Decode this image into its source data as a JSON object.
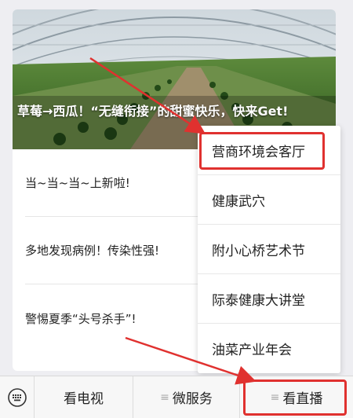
{
  "article": {
    "hero_title": "草莓→西瓜！“无缝衔接”的甜蜜快乐，快来Get!",
    "items": [
      {
        "title": "当~当~当~上新啦!"
      },
      {
        "title": "多地发现病例！传染性强!"
      },
      {
        "title": "警惕夏季“头号杀手”!"
      }
    ]
  },
  "menu": {
    "items": [
      {
        "label": "营商环境会客厅",
        "highlighted": true
      },
      {
        "label": "健康武穴"
      },
      {
        "label": "附小心桥艺术节"
      },
      {
        "label": "际泰健康大讲堂"
      },
      {
        "label": "油菜产业年会"
      }
    ]
  },
  "bottom_bar": {
    "keyboard_icon": "keyboard-icon",
    "tabs": [
      {
        "label": "看电视",
        "has_menu_icon": false
      },
      {
        "label": "微服务",
        "has_menu_icon": true
      },
      {
        "label": "看直播",
        "has_menu_icon": true,
        "highlighted": true
      }
    ]
  },
  "colors": {
    "highlight_red": "#e0312f",
    "background": "#eeeef2"
  }
}
